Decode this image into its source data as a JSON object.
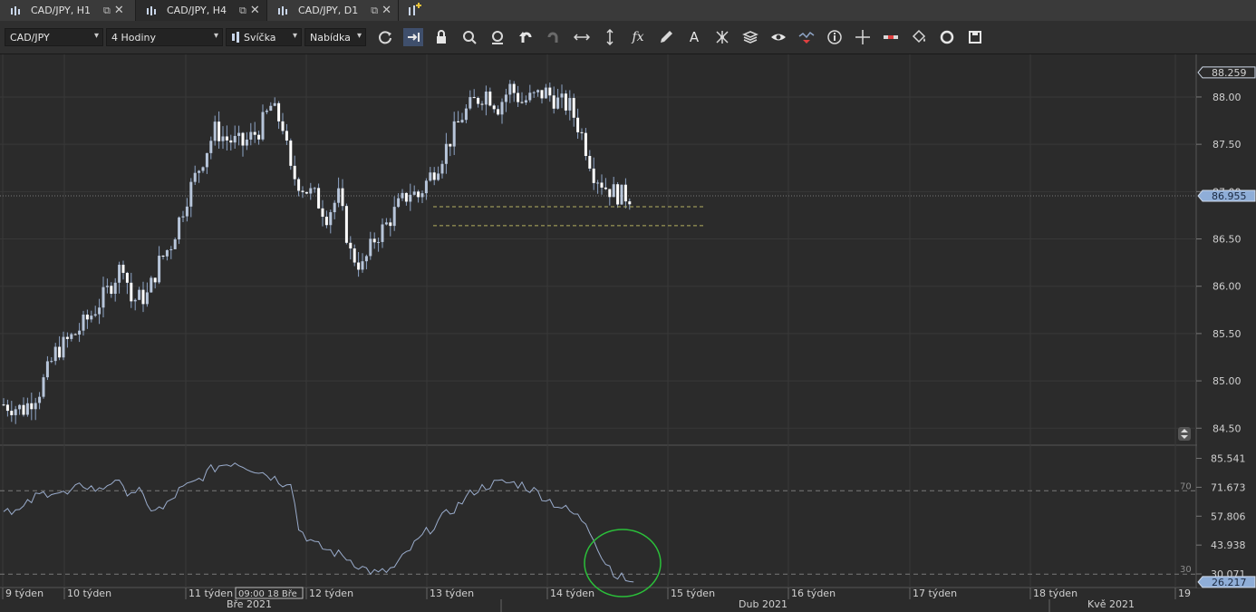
{
  "tabs": [
    {
      "label": "CAD/JPY, H1",
      "active": false
    },
    {
      "label": "CAD/JPY, H4",
      "active": true
    },
    {
      "label": "CAD/JPY, D1",
      "active": false
    }
  ],
  "toolbar": {
    "symbol": "CAD/JPY",
    "timeframe": "4 Hodiny",
    "chart_style": "Svíčka",
    "price_side": "Nabídka",
    "icons": [
      "refresh-icon",
      "shift-right-icon",
      "lock-icon",
      "zoom-in-icon",
      "zoom-out-icon",
      "undo-icon",
      "redo-icon",
      "horizontal-line-icon",
      "vertical-line-icon",
      "function-icon",
      "pencil-icon",
      "text-icon",
      "pattern-icon",
      "layers-icon",
      "eye-icon",
      "indicator-icon",
      "info-icon",
      "crosshair-icon",
      "ruler-icon",
      "paint-bucket-icon",
      "cycle-icon",
      "save-icon"
    ]
  },
  "colors": {
    "background": "#2b2b2b",
    "candle": "#8ea4c6",
    "candle_up": "#b7c5da",
    "candle_down": "#ffffff",
    "grid": "#383838",
    "level_line": "#b5b060",
    "rsi_line": "#9aaccc",
    "highlight_circle": "#2bbf3a",
    "price_badge": "#8faed8"
  },
  "chart_data": [
    {
      "type": "candlestick",
      "timeframe": "4 Hodiny",
      "ylim": [
        84.33,
        88.45
      ],
      "y_ticks": [
        "88.00",
        "87.50",
        "87.00",
        "86.50",
        "86.00",
        "85.50",
        "85.00",
        "84.50"
      ],
      "current_price": "86.955",
      "high_label": "88.259",
      "levels": [
        86.84,
        86.64
      ],
      "close_path": [
        [
          0,
          84.75
        ],
        [
          5,
          84.7
        ],
        [
          9,
          84.9
        ],
        [
          13,
          85.3
        ],
        [
          18,
          85.5
        ],
        [
          22,
          85.7
        ],
        [
          26,
          85.95
        ],
        [
          30,
          86.25
        ],
        [
          32,
          85.85
        ],
        [
          36,
          85.9
        ],
        [
          39,
          86.25
        ],
        [
          42,
          86.45
        ],
        [
          46,
          86.95
        ],
        [
          50,
          87.35
        ],
        [
          53,
          87.65
        ],
        [
          56,
          87.55
        ],
        [
          60,
          87.5
        ],
        [
          64,
          87.65
        ],
        [
          67,
          87.9
        ],
        [
          70,
          87.7
        ],
        [
          72,
          87.2
        ],
        [
          75,
          87.05
        ],
        [
          78,
          86.95
        ],
        [
          81,
          86.75
        ],
        [
          84,
          86.95
        ],
        [
          87,
          86.35
        ],
        [
          90,
          86.2
        ],
        [
          93,
          86.5
        ],
        [
          96,
          86.65
        ],
        [
          99,
          86.85
        ],
        [
          102,
          87.0
        ],
        [
          104,
          86.95
        ],
        [
          106,
          87.1
        ],
        [
          109,
          87.3
        ],
        [
          112,
          87.55
        ],
        [
          115,
          87.8
        ],
        [
          118,
          87.95
        ],
        [
          121,
          88.05
        ],
        [
          124,
          87.9
        ],
        [
          127,
          88.1
        ],
        [
          130,
          87.95
        ],
        [
          133,
          88.0
        ],
        [
          136,
          88.05
        ],
        [
          139,
          87.95
        ],
        [
          142,
          87.9
        ],
        [
          145,
          87.6
        ],
        [
          148,
          87.2
        ],
        [
          151,
          87.05
        ],
        [
          154,
          86.97
        ],
        [
          157,
          86.95
        ]
      ],
      "x_ticks": [
        "9 týden",
        "10 týden",
        "11 týden",
        "12 týden",
        "13 týden",
        "14 týden",
        "15 týden",
        "16 týden",
        "17 týden",
        "18 týden",
        "19"
      ],
      "months": [
        "Bře 2021",
        "Dub 2021",
        "Kvě 2021"
      ],
      "cursor_time": "09:00 18 Bře"
    },
    {
      "type": "line",
      "indicator": "RSI",
      "ylim": [
        24.0,
        91.0
      ],
      "y_ticks": [
        "85.541",
        "71.673",
        "57.806",
        "43.938",
        "30.071"
      ],
      "levels": [
        70,
        30
      ],
      "level_labels": [
        "70",
        "30"
      ],
      "current_value": "26.217",
      "values": [
        [
          0,
          62
        ],
        [
          4,
          60
        ],
        [
          8,
          67
        ],
        [
          12,
          70
        ],
        [
          16,
          68
        ],
        [
          20,
          73
        ],
        [
          24,
          70
        ],
        [
          28,
          76
        ],
        [
          30,
          70
        ],
        [
          34,
          70
        ],
        [
          36,
          62
        ],
        [
          40,
          61
        ],
        [
          44,
          70
        ],
        [
          48,
          74
        ],
        [
          52,
          80
        ],
        [
          54,
          82
        ],
        [
          58,
          84
        ],
        [
          62,
          81
        ],
        [
          66,
          78
        ],
        [
          70,
          74
        ],
        [
          72,
          75
        ],
        [
          74,
          52
        ],
        [
          78,
          44
        ],
        [
          82,
          41
        ],
        [
          86,
          38
        ],
        [
          90,
          33
        ],
        [
          94,
          30
        ],
        [
          98,
          33
        ],
        [
          102,
          42
        ],
        [
          106,
          50
        ],
        [
          110,
          57
        ],
        [
          114,
          63
        ],
        [
          118,
          70
        ],
        [
          122,
          73
        ],
        [
          126,
          74
        ],
        [
          130,
          73
        ],
        [
          134,
          69
        ],
        [
          138,
          64
        ],
        [
          142,
          60
        ],
        [
          146,
          55
        ],
        [
          148,
          48
        ],
        [
          150,
          38
        ],
        [
          154,
          29
        ],
        [
          158,
          26.2
        ]
      ]
    }
  ]
}
